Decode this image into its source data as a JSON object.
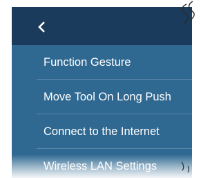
{
  "header": {
    "back_icon": "chevron-left-icon"
  },
  "menu": {
    "items": [
      {
        "label": "Function Gesture"
      },
      {
        "label": "Move Tool On Long Push"
      },
      {
        "label": "Connect to the Internet"
      },
      {
        "label": "Wireless LAN Settings"
      }
    ]
  },
  "colors": {
    "title_bar": "#1b3b5c",
    "panel": "#2f6891",
    "divider": "#5a87a8",
    "text": "#ffffff"
  }
}
